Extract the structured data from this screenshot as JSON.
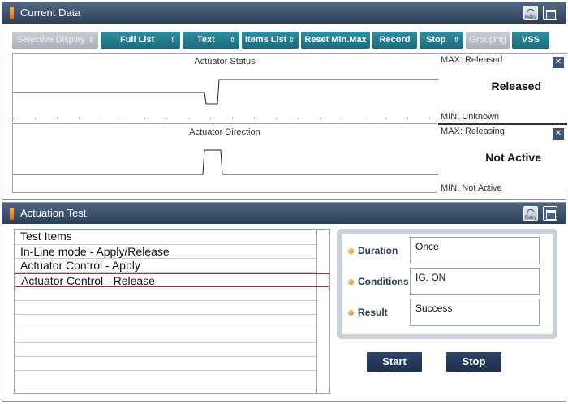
{
  "current_data": {
    "title": "Current Data",
    "retry_label": "Retry",
    "toolbar": {
      "selective_display": "Selective Display",
      "full_list": "Full List",
      "text": "Text",
      "items_list": "Items List",
      "reset_min_max": "Reset Min.Max",
      "record": "Record",
      "stop": "Stop",
      "grouping": "Grouping",
      "vss": "VSS",
      "arrows": "⇕"
    },
    "graphs": [
      {
        "title": "Actuator Status",
        "max": "MAX: Released",
        "current": "Released",
        "min": "MIN: Unknown",
        "close": "✕"
      },
      {
        "title": "Actuator Direction",
        "max": "MAX: Releasing",
        "current": "Not Active",
        "min": "MIN: Not Active",
        "close": "✕"
      }
    ]
  },
  "actuation_test": {
    "title": "Actuation Test",
    "retry_label": "Retry",
    "list_header": "Test Items",
    "items": [
      "In-Line mode - Apply/Release",
      "Actuator Control - Apply",
      "Actuator Control - Release"
    ],
    "selected_index": 2,
    "info": {
      "duration_label": "Duration",
      "duration_value": "Once",
      "conditions_label": "Conditions",
      "conditions_value": "IG. ON",
      "result_label": "Result",
      "result_value": "Success"
    },
    "start_label": "Start",
    "stop_label": "Stop"
  },
  "colors": {
    "header": "#2c3f57",
    "toolbar_button": "#1b6b7c",
    "action_button": "#1d3050",
    "selected_outline": "#d42020"
  }
}
